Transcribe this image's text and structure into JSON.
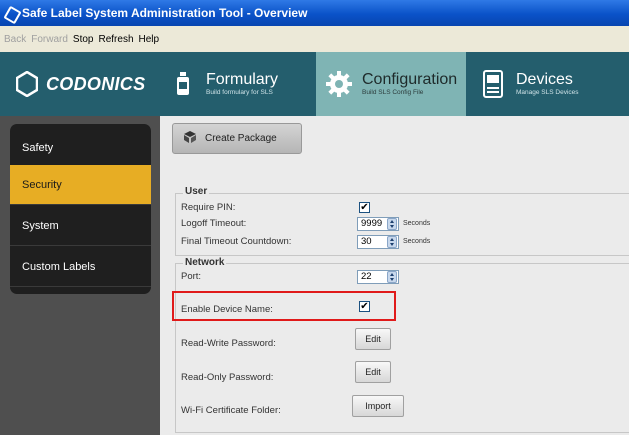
{
  "window": {
    "title": "Safe Label System Administration Tool - Overview"
  },
  "menu": [
    {
      "label": "Back",
      "enabled": false
    },
    {
      "label": "Forward",
      "enabled": false
    },
    {
      "label": "Stop",
      "enabled": true
    },
    {
      "label": "Refresh",
      "enabled": true
    },
    {
      "label": "Help",
      "enabled": true
    }
  ],
  "header": {
    "logo": "CODONICS",
    "nav": [
      {
        "title": "Formulary",
        "subtitle": "Build formulary for SLS",
        "icon": "bottle-icon",
        "active": false
      },
      {
        "title": "Configuration",
        "subtitle": "Build SLS Config File",
        "icon": "gear-icon",
        "active": true
      },
      {
        "title": "Devices",
        "subtitle": "Manage SLS Devices",
        "icon": "device-icon",
        "active": false
      }
    ]
  },
  "sidebar": {
    "items": [
      {
        "label": "Safety",
        "active": false
      },
      {
        "label": "Security",
        "active": true
      },
      {
        "label": "System",
        "active": false
      },
      {
        "label": "Custom Labels",
        "active": false
      }
    ]
  },
  "main": {
    "create_package": "Create Package",
    "user": {
      "legend": "User",
      "require_pin_label": "Require PIN:",
      "require_pin_checked": true,
      "logoff_label": "Logoff Timeout:",
      "logoff_value": "9999",
      "logoff_unit": "Seconds",
      "final_label": "Final Timeout Countdown:",
      "final_value": "30",
      "final_unit": "Seconds"
    },
    "network": {
      "legend": "Network",
      "port_label": "Port:",
      "port_value": "22",
      "device_name_label": "Enable Device Name:",
      "device_name_checked": true,
      "rw_password_label": "Read-Write Password:",
      "rw_button": "Edit",
      "ro_password_label": "Read-Only Password:",
      "ro_button": "Edit",
      "wifi_label": "Wi-Fi Certificate Folder:",
      "wifi_button": "Import"
    }
  },
  "colors": {
    "header_bg": "#245e6d",
    "active_nav_bg": "#7fb4b4",
    "sidebar_active": "#e7ad24",
    "highlight_box": "#e01a1a"
  }
}
